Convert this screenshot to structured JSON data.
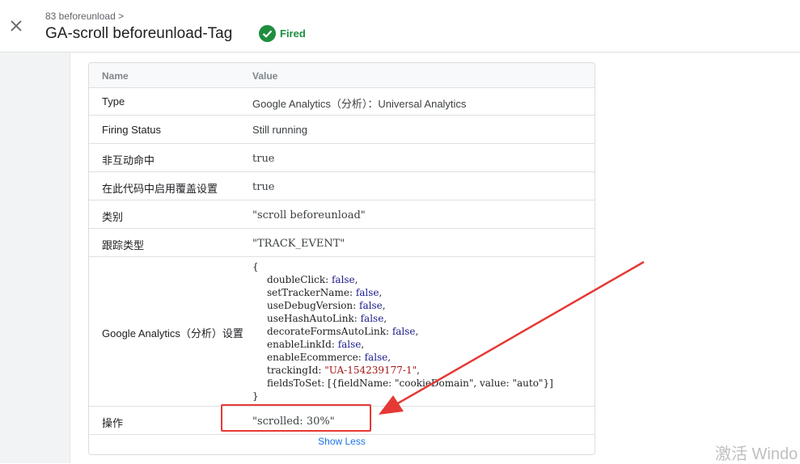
{
  "header": {
    "breadcrumb": "83 beforeunload >",
    "title": "GA-scroll beforeunload-Tag",
    "status": "Fired",
    "status_color": "#1e8e3e"
  },
  "table": {
    "col_name": "Name",
    "col_value": "Value",
    "rows": [
      {
        "name": "Type",
        "value": "Google Analytics（分析）：Universal Analytics"
      },
      {
        "name": "Firing Status",
        "value": "Still running"
      },
      {
        "name": "非互动命中",
        "value": "true"
      },
      {
        "name": "在此代码中启用覆盖设置",
        "value": "true"
      },
      {
        "name": "类别",
        "value": "\"scroll beforeunload\""
      },
      {
        "name": "跟踪类型",
        "value": "\"TRACK_EVENT\""
      },
      {
        "name": "Google Analytics（分析）设置",
        "open": "{",
        "close": "}",
        "fields": [
          {
            "key": "doubleClick",
            "value": "false"
          },
          {
            "key": "setTrackerName",
            "value": "false"
          },
          {
            "key": "useDebugVersion",
            "value": "false"
          },
          {
            "key": "useHashAutoLink",
            "value": "false"
          },
          {
            "key": "decorateFormsAutoLink",
            "value": "false"
          },
          {
            "key": "enableLinkId",
            "value": "false"
          },
          {
            "key": "enableEcommerce",
            "value": "false"
          },
          {
            "key": "trackingId",
            "value": "\"UA-154239177-1\""
          },
          {
            "key": "fieldsToSet",
            "value": "[{fieldName: \"cookieDomain\", value: \"auto\"}]"
          }
        ]
      },
      {
        "name": "操作",
        "value": "\"scrolled: 30%\""
      }
    ],
    "show_less": "Show Less"
  },
  "annotation_color": "#e53935",
  "watermark": "激活 Windo"
}
